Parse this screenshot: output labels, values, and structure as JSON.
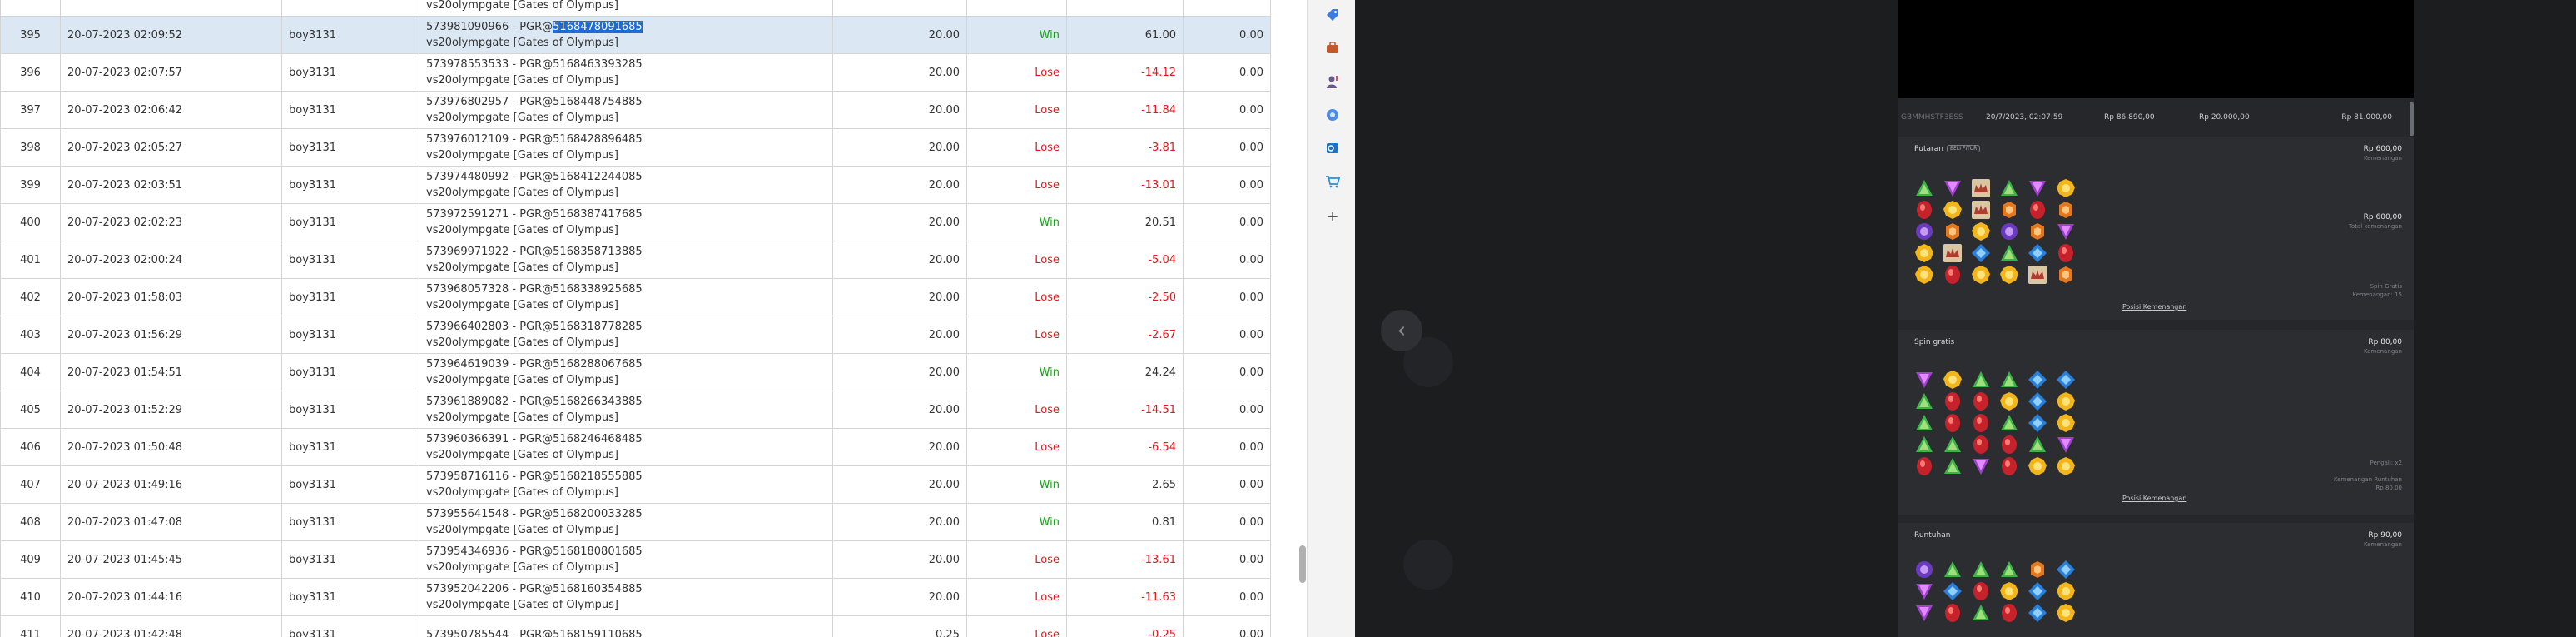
{
  "table": {
    "rows": [
      {
        "no": "",
        "date": "",
        "user": "",
        "tx1": "",
        "tx2": "vs20olympgate [Gates of Olympus]",
        "bet": "",
        "result": "",
        "win": "",
        "jp": "",
        "partial": true
      },
      {
        "no": "395",
        "date": "20-07-2023 02:09:52",
        "user": "boy3131",
        "tx1a": "573981090966 - PGR@",
        "tx1b": "5168478091685",
        "tx2": "vs20olympgate [Gates of Olympus]",
        "bet": "20.00",
        "result": "Win",
        "win": "61.00",
        "jp": "0.00",
        "selected": true
      },
      {
        "no": "396",
        "date": "20-07-2023 02:07:57",
        "user": "boy3131",
        "tx1": "573978553533 - PGR@5168463393285",
        "tx2": "vs20olympgate [Gates of Olympus]",
        "bet": "20.00",
        "result": "Lose",
        "win": "-14.12",
        "jp": "0.00"
      },
      {
        "no": "397",
        "date": "20-07-2023 02:06:42",
        "user": "boy3131",
        "tx1": "573976802957 - PGR@5168448754885",
        "tx2": "vs20olympgate [Gates of Olympus]",
        "bet": "20.00",
        "result": "Lose",
        "win": "-11.84",
        "jp": "0.00"
      },
      {
        "no": "398",
        "date": "20-07-2023 02:05:27",
        "user": "boy3131",
        "tx1": "573976012109 - PGR@5168428896485",
        "tx2": "vs20olympgate [Gates of Olympus]",
        "bet": "20.00",
        "result": "Lose",
        "win": "-3.81",
        "jp": "0.00"
      },
      {
        "no": "399",
        "date": "20-07-2023 02:03:51",
        "user": "boy3131",
        "tx1": "573974480992 - PGR@5168412244085",
        "tx2": "vs20olympgate [Gates of Olympus]",
        "bet": "20.00",
        "result": "Lose",
        "win": "-13.01",
        "jp": "0.00"
      },
      {
        "no": "400",
        "date": "20-07-2023 02:02:23",
        "user": "boy3131",
        "tx1": "573972591271 - PGR@5168387417685",
        "tx2": "vs20olympgate [Gates of Olympus]",
        "bet": "20.00",
        "result": "Win",
        "win": "20.51",
        "jp": "0.00"
      },
      {
        "no": "401",
        "date": "20-07-2023 02:00:24",
        "user": "boy3131",
        "tx1": "573969971922 - PGR@5168358713885",
        "tx2": "vs20olympgate [Gates of Olympus]",
        "bet": "20.00",
        "result": "Lose",
        "win": "-5.04",
        "jp": "0.00"
      },
      {
        "no": "402",
        "date": "20-07-2023 01:58:03",
        "user": "boy3131",
        "tx1": "573968057328 - PGR@5168338925685",
        "tx2": "vs20olympgate [Gates of Olympus]",
        "bet": "20.00",
        "result": "Lose",
        "win": "-2.50",
        "jp": "0.00"
      },
      {
        "no": "403",
        "date": "20-07-2023 01:56:29",
        "user": "boy3131",
        "tx1": "573966402803 - PGR@5168318778285",
        "tx2": "vs20olympgate [Gates of Olympus]",
        "bet": "20.00",
        "result": "Lose",
        "win": "-2.67",
        "jp": "0.00"
      },
      {
        "no": "404",
        "date": "20-07-2023 01:54:51",
        "user": "boy3131",
        "tx1": "573964619039 - PGR@5168288067685",
        "tx2": "vs20olympgate [Gates of Olympus]",
        "bet": "20.00",
        "result": "Win",
        "win": "24.24",
        "jp": "0.00"
      },
      {
        "no": "405",
        "date": "20-07-2023 01:52:29",
        "user": "boy3131",
        "tx1": "573961889082 - PGR@5168266343885",
        "tx2": "vs20olympgate [Gates of Olympus]",
        "bet": "20.00",
        "result": "Lose",
        "win": "-14.51",
        "jp": "0.00"
      },
      {
        "no": "406",
        "date": "20-07-2023 01:50:48",
        "user": "boy3131",
        "tx1": "573960366391 - PGR@5168246468485",
        "tx2": "vs20olympgate [Gates of Olympus]",
        "bet": "20.00",
        "result": "Lose",
        "win": "-6.54",
        "jp": "0.00"
      },
      {
        "no": "407",
        "date": "20-07-2023 01:49:16",
        "user": "boy3131",
        "tx1": "573958716116 - PGR@5168218555885",
        "tx2": "vs20olympgate [Gates of Olympus]",
        "bet": "20.00",
        "result": "Win",
        "win": "2.65",
        "jp": "0.00"
      },
      {
        "no": "408",
        "date": "20-07-2023 01:47:08",
        "user": "boy3131",
        "tx1": "573955641548 - PGR@5168200033285",
        "tx2": "vs20olympgate [Gates of Olympus]",
        "bet": "20.00",
        "result": "Win",
        "win": "0.81",
        "jp": "0.00"
      },
      {
        "no": "409",
        "date": "20-07-2023 01:45:45",
        "user": "boy3131",
        "tx1": "573954346936 - PGR@5168180801685",
        "tx2": "vs20olympgate [Gates of Olympus]",
        "bet": "20.00",
        "result": "Lose",
        "win": "-13.61",
        "jp": "0.00"
      },
      {
        "no": "410",
        "date": "20-07-2023 01:44:16",
        "user": "boy3131",
        "tx1": "573952042206 - PGR@5168160354885",
        "tx2": "vs20olympgate [Gates of Olympus]",
        "bet": "20.00",
        "result": "Lose",
        "win": "-11.63",
        "jp": "0.00"
      },
      {
        "no": "411",
        "date": "20-07-2023 01:42:48",
        "user": "boy3131",
        "tx1": "573950785544 - PGR@5168159110685",
        "tx2": "",
        "bet": "0.25",
        "result": "Lose",
        "win": "-0.25",
        "jp": "0.00"
      }
    ]
  },
  "side_strip": {
    "icons": [
      "tag-icon",
      "briefcase-icon",
      "person-icon",
      "gear-icon",
      "outlook-icon",
      "shopping-cart-icon",
      "plus-icon"
    ],
    "plus_label": "+"
  },
  "overlay": {
    "back_glyph": "‹"
  },
  "panel": {
    "summary": {
      "id": "GBMMHSTF3ESS",
      "date": "20/7/2023, 02:07:59",
      "bet": "Rp 86.890,00",
      "win": "Rp 20.000,00",
      "total": "Rp 81.000,00"
    },
    "sections": [
      {
        "title": "Putaran",
        "badge": "BELI FITUR",
        "amount": "Rp 600,00",
        "amount_label": "Kemenangan",
        "mid_value": "Rp 600,00",
        "mid_label": "Total kemenangan",
        "small1": "Spin Gratis",
        "small2": "Kemenangan: 15",
        "link": "Posisi Kemenangan",
        "grid": [
          "green-tri",
          "purple-tri",
          "crown",
          "green-tri",
          "purple-tri",
          "yellow-gem",
          "red-gem",
          "yellow-gem",
          "crown",
          "orange-gem",
          "red-gem",
          "orange-gem",
          "purple-gem",
          "orange-gem",
          "yellow-gem",
          "purple-gem",
          "orange-gem",
          "purple-tri",
          "yellow-gem",
          "crown",
          "blue-gem",
          "green-tri",
          "blue-gem",
          "red-gem",
          "yellow-gem",
          "red-gem",
          "yellow-gem",
          "yellow-gem",
          "crown",
          "orange-gem"
        ]
      },
      {
        "title": "Spin gratis",
        "amount": "Rp 80,00",
        "amount_label": "Kemenangan",
        "small1": "Pengali: x2",
        "small2": "Kemenangan Runtuhan",
        "small3": "Rp 80,00",
        "link": "Posisi Kemenangan",
        "grid": [
          "purple-tri",
          "yellow-gem",
          "green-tri",
          "green-tri",
          "blue-gem",
          "blue-gem",
          "green-tri",
          "red-gem",
          "red-gem",
          "yellow-gem",
          "blue-gem",
          "yellow-gem",
          "green-tri",
          "red-gem",
          "red-gem",
          "green-tri",
          "blue-gem",
          "yellow-gem",
          "green-tri",
          "green-tri",
          "red-gem",
          "red-gem",
          "green-tri",
          "purple-tri",
          "red-gem",
          "green-tri",
          "purple-tri",
          "red-gem",
          "yellow-gem",
          "yellow-gem"
        ]
      },
      {
        "title": "Runtuhan",
        "amount": "Rp 90,00",
        "amount_label": "Kemenangan",
        "grid": [
          "purple-gem",
          "green-tri",
          "green-tri",
          "green-tri",
          "orange-gem",
          "blue-gem",
          "purple-tri",
          "blue-gem",
          "red-gem",
          "yellow-gem",
          "blue-gem",
          "yellow-gem",
          "purple-tri",
          "red-gem",
          "green-tri",
          "red-gem",
          "blue-gem",
          "yellow-gem"
        ]
      }
    ]
  }
}
